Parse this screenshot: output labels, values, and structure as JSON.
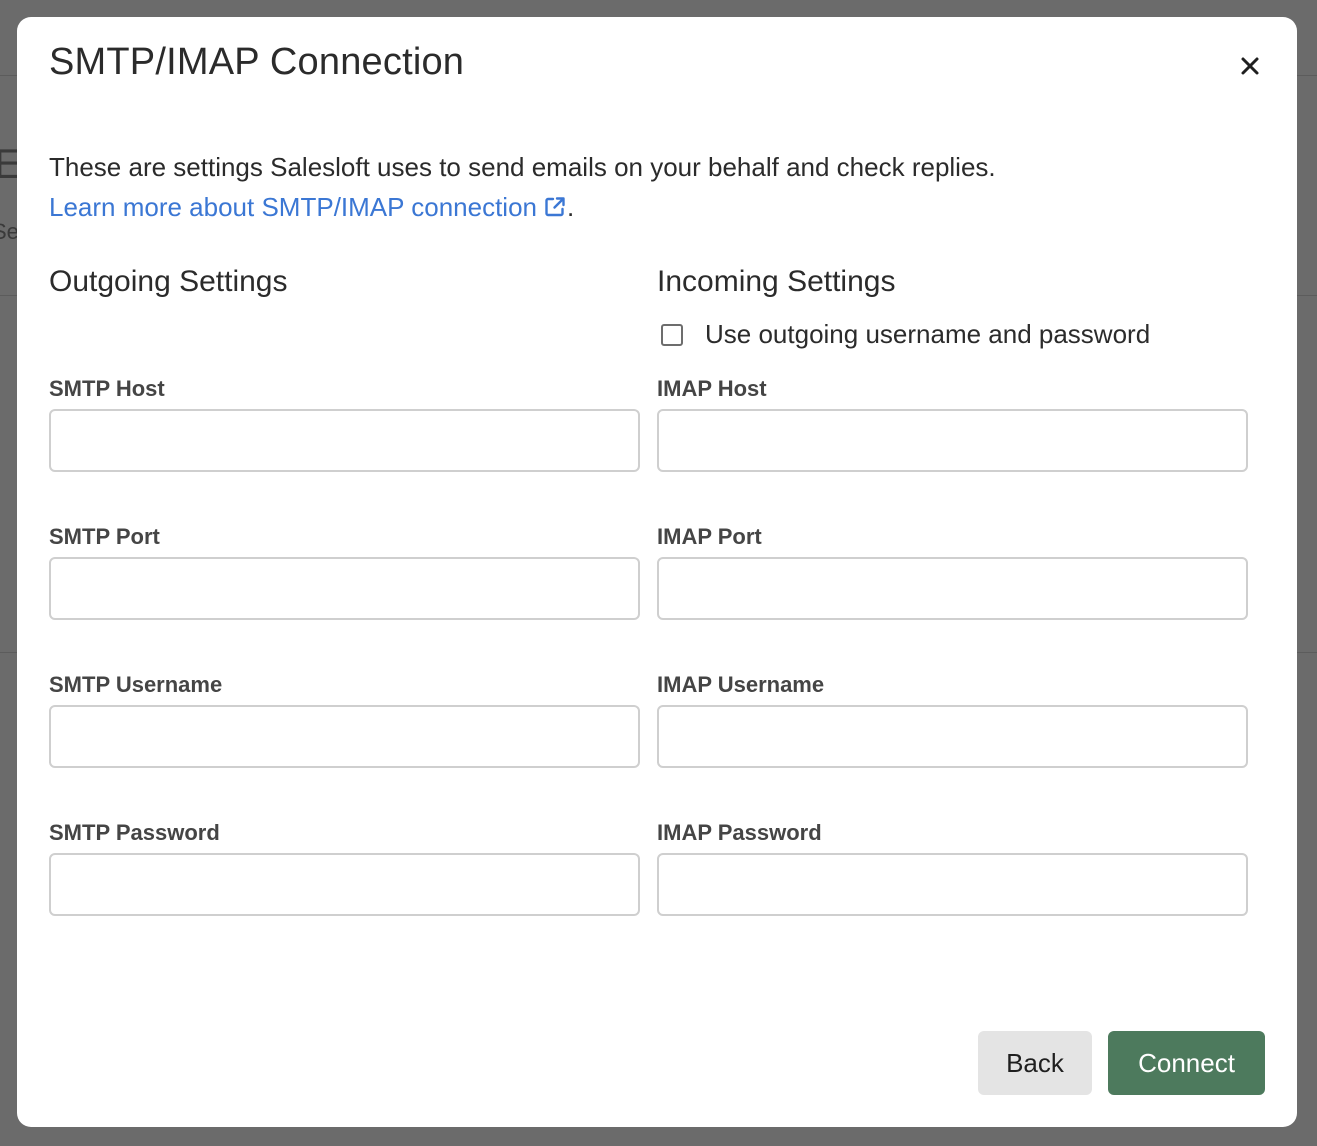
{
  "dialog": {
    "title": "SMTP/IMAP Connection",
    "close_label": "×",
    "description": "These are settings Salesloft uses to send emails on your behalf and check replies.",
    "learn_more_link": "Learn more about SMTP/IMAP connection",
    "learn_more_suffix": "."
  },
  "outgoing": {
    "heading": "Outgoing Settings",
    "fields": [
      {
        "label": "SMTP Host",
        "value": ""
      },
      {
        "label": "SMTP Port",
        "value": ""
      },
      {
        "label": "SMTP Username",
        "value": ""
      },
      {
        "label": "SMTP Password",
        "value": ""
      }
    ]
  },
  "incoming": {
    "heading": "Incoming Settings",
    "use_outgoing_checkbox": {
      "label": "Use outgoing username and password",
      "checked": false
    },
    "fields": [
      {
        "label": "IMAP Host",
        "value": ""
      },
      {
        "label": "IMAP Port",
        "value": ""
      },
      {
        "label": "IMAP Username",
        "value": ""
      },
      {
        "label": "IMAP Password",
        "value": ""
      }
    ]
  },
  "footer": {
    "back_label": "Back",
    "connect_label": "Connect"
  },
  "background": {
    "glyph_1": "E",
    "glyph_2": "Se"
  },
  "colors": {
    "link": "#3b77d4",
    "primary_button": "#4d7a5d",
    "secondary_button": "#e4e4e4",
    "overlay": "#6b6b6b"
  }
}
